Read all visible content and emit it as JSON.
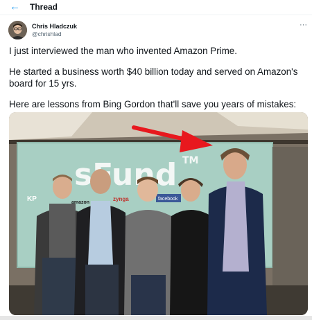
{
  "header": {
    "back_icon": "arrow-left-icon",
    "title": "Thread"
  },
  "author": {
    "name": "Chris Hladczuk",
    "handle": "@chrishlad",
    "avatar_icon": "avatar-photo"
  },
  "more_icon": "more-options-icon",
  "tweet": {
    "lines": [
      "I just interviewed the man who invented Amazon Prime.",
      "He started a business worth $40 billion today and served on Amazon's board for 15 yrs.",
      "Here are lessons from Bing Gordon that'll save you years of mistakes:"
    ]
  },
  "photo": {
    "backdrop_text": "sFund",
    "backdrop_tm": "TM",
    "logos": [
      "KP",
      "amazon",
      "zynga",
      "facebook"
    ],
    "annotation": "red-arrow-pointing-right-person"
  },
  "colors": {
    "accent": "#1d9bf0",
    "text": "#0f1419",
    "muted": "#536471",
    "arrow": "#e8181e"
  }
}
